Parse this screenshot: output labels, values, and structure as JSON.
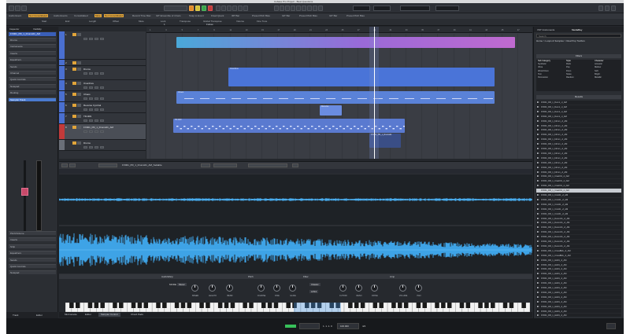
{
  "window": {
    "title": "Cubase Pro Project - Beat Questions"
  },
  "info_line": {
    "labels": [
      "Audio Event",
      "Not Consolidated",
      "Audio Events",
      "Consolidated",
      "Mute",
      "Not Consolidated",
      "Record Time Max",
      "IHT Ensemble of 4 bars",
      "Snap to Event",
      "Fixed Quant",
      "IRT Bar",
      "Preset Pitch Bias",
      "IHT Bar",
      "Preset Pitch Bias",
      "IHT Bar",
      "Preset Pitch Bias"
    ],
    "fields": [
      "Start",
      "End",
      "Length",
      "Offset",
      "Mute",
      "Lock",
      "Transpose",
      "Global Transpose",
      "Volume",
      "Fine Tune"
    ],
    "values": [
      "",
      "",
      "",
      "",
      "",
      "1",
      "",
      "Follow",
      "",
      ""
    ]
  },
  "inspector": {
    "tabs": [
      "Inspector",
      "Visibility"
    ],
    "selected_track": "FX001_PR_1_Drums01_AM",
    "rows": [
      "Drums",
      "Instruments",
      "Inserts",
      "Equalizers",
      "Sends",
      "Channel",
      "Quick Controls",
      "Notepad",
      "Routing",
      "Sampler Track",
      "Pitch/Volume",
      "Inserts",
      "Strip",
      "Equalizers",
      "Sends",
      "Quick Controls",
      "Notepad"
    ],
    "bottom_tabs": [
      "Track",
      "Editor"
    ]
  },
  "tracks": [
    {
      "num": "1",
      "name": "",
      "color": "#4a6fd0"
    },
    {
      "num": "2",
      "name": "",
      "color": "#4a6fd0"
    },
    {
      "num": "3",
      "name": "Drums",
      "color": "#4a6fd0"
    },
    {
      "num": "4",
      "name": "Overdrive",
      "color": "#4a6fd0"
    },
    {
      "num": "5",
      "name": "Chaos",
      "color": "#4a6fd0"
    },
    {
      "num": "6",
      "name": "Reverse Cymbal",
      "color": "#4a6fd0"
    },
    {
      "num": "7",
      "name": "TR-909",
      "color": "#4a6fd0"
    },
    {
      "num": "8",
      "name": "FX001_PR_1_Drums01_AM",
      "color": "#c23a3a"
    },
    {
      "num": "",
      "name": "Drums",
      "color": "#6a6f78"
    }
  ],
  "ruler": {
    "ticks": [
      "1",
      "3",
      "5",
      "7",
      "9",
      "11",
      "13",
      "15",
      "17",
      "19",
      "21",
      "23",
      "25",
      "27",
      "29",
      "31",
      "33",
      "35",
      "37",
      "39",
      "41",
      "43",
      "45",
      "47"
    ]
  },
  "events": [
    {
      "label": "",
      "track": "1"
    },
    {
      "label": "Overdrive",
      "track": "4"
    },
    {
      "label": "Chaos",
      "track": "5"
    },
    {
      "label": "Reverse",
      "track": "6"
    },
    {
      "label": "TR-909",
      "track": "7"
    },
    {
      "label": "FX001_PR_1_Drums01",
      "track": "8"
    }
  ],
  "right_zone": {
    "tabs": [
      "VST Instruments",
      "MediaBay"
    ],
    "search_placeholder": "Search",
    "path": "Home > Loops & Samples > Real Pop Toolbox",
    "filters_title": "Filters",
    "filter_columns": [
      {
        "header": "Sub Category",
        "items": [
          "Synthetic",
          "Vibra",
          "Wood Drum",
          "Tom",
          "Percussion"
        ]
      },
      {
        "header": "Style",
        "items": [
          "Rock",
          "Pop",
          "Drum",
          "Noise",
          "Random"
        ]
      },
      {
        "header": "Character",
        "items": [
          "Acoustic",
          "Mellow",
          "Soft",
          "Bright",
          "Metallic"
        ]
      }
    ],
    "results_title": "Results",
    "results": [
      "FX001_DR_1_Dum1_vl_AM",
      "FX001_DR_1_Dum1_vl_AM",
      "FX001_DR_1_Dum1_vl_AM",
      "FX001_DR_1_Dum1_vl_AM",
      "FX001_DR_1_Fdrm1_vl_AM",
      "FX001_DR_1_Fdrm1_vl_AM",
      "FX001_DR_1_Fdrm1_vl_AM",
      "FX001_DR_1_Fdrm1_vl_AM",
      "FX001_DR_1_Fdrm1_vl_AM",
      "FX001_DR_1_Fdrm1_vl_AM",
      "FX001_DR_1_Fdrm1_vl_AM",
      "FX001_DR_1_Fdrm1_vl_AM",
      "FX001_DR_1_Fdrm1_vl_AM",
      "FX001_DR_1_Fdrm1_vl_AM",
      "FX001_DR_1_Fdrm1_vl_AM",
      "FX001_DR_1_Fdrm1_vl_AM",
      "FX001_DR_1_Crash01_vl_AM",
      "FX001_DR_1_Crash01_vl_AM",
      "FX001_DR_1_Crash01_vl_AM",
      "FX001_DR_1_Crash01_vl_AM",
      "FX001_DR_1_Cnrs01_vl_AM",
      "FX001_DR_1_Cnrs01_vl_AM",
      "FX001_DR_1_Cnrs01_vl_AM",
      "FX001_DR_1_Cnrs01_vl_AM",
      "FX001_DR_1_Cnrs01_vl_AM",
      "FX001_DR_1_Dumm01_vl_AM",
      "FX001_DR_1_Dumm01_vl_AM",
      "FX001_DR_1_Dumm01_vl_AM",
      "FX001_DR_1_Dumm01_vl_AM",
      "FX001_DR_1_Dumm01_vl_AM",
      "FX001_DR_1_Dumm01_vl_AM",
      "FX001_DR_1_Dumm01_vl_AM",
      "FX001_DR_1_CrossBlck_vl_AM",
      "FX001_DR_1_CrossBlck_vl_AM",
      "FX001_DR_1_HH01_vl_AM",
      "FX001_DR_1_HH01_vl_AM",
      "FX001_DR_1_HH01_vl_AM",
      "FX001_DR_1_HH01_vl_AM",
      "FX001_DR_1_HH01_vl_AM",
      "FX001_DR_1_HH01_vl_AM",
      "FX001_DR_1_HH01_vl_AM",
      "FX001_DR_1_HH01_vl_AM",
      "FX001_DR_1_HH01_vl_AM",
      "FX001_DR_1_HH01_vl_AM",
      "FX001_DR_1_HH01_vl_AM",
      "FX001_DR_1_HH01_vl_AM",
      "FX001_DR_1_HH01_vl_AM"
    ],
    "selected_result_index": 19
  },
  "sample_editor": {
    "event_name": "FX001_PR_1_Drums01_AM_Seltable",
    "sections": [
      "AudioWarp",
      "Pitch",
      "Filter",
      "Amp"
    ],
    "knob_labels": [
      "MODE",
      "SPEED",
      "LEGATO",
      "BEND",
      "COARSE",
      "FINE",
      "GLIDE",
      "CUTOFF",
      "RESO",
      "DRIVE",
      "VOLUME",
      "PAN"
    ],
    "mode_value": "Music",
    "filter_type": "Classic",
    "shape_value": "LP24"
  },
  "lower_tabs": [
    "MixConsole",
    "Editor",
    "Sampler Control",
    "Chord Pads"
  ],
  "status": {
    "position": "1. 1. 1. 0",
    "tempo": "100.000",
    "signature": "4/4"
  }
}
